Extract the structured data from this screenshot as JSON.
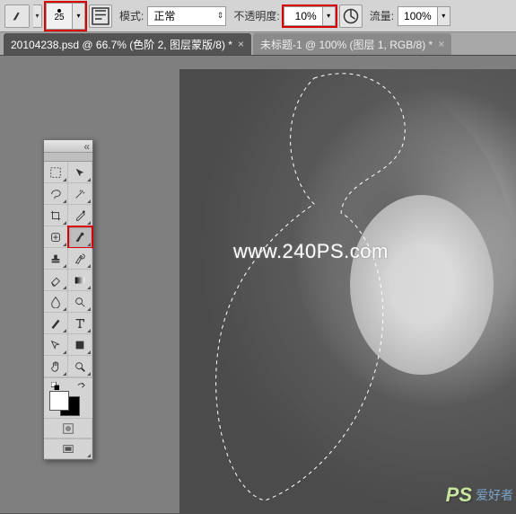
{
  "options_bar": {
    "brush_size": "25",
    "mode_label": "模式:",
    "mode_value": "正常",
    "opacity_label": "不透明度:",
    "opacity_value": "10%",
    "flow_label": "流量:",
    "flow_value": "100%"
  },
  "tabs": [
    {
      "label": "20104238.psd @ 66.7% (色阶 2, 图层蒙版/8) *",
      "active": true
    },
    {
      "label": "未标题-1 @ 100% (图层 1, RGB/8) *",
      "active": false
    }
  ],
  "watermarks": {
    "main": "www.240PS.com",
    "bottom_logo": "PS",
    "bottom_text": "爱好者"
  },
  "tools": {
    "items": [
      [
        "marquee-icon",
        "move-icon"
      ],
      [
        "lasso-icon",
        "wand-icon"
      ],
      [
        "crop-icon",
        "eyedrop-icon"
      ],
      [
        "heal-icon",
        "brush-icon"
      ],
      [
        "stamp-icon",
        "history-brush-icon"
      ],
      [
        "eraser-icon",
        "gradient-icon"
      ],
      [
        "blur-icon",
        "dodge-icon"
      ],
      [
        "pen-icon",
        "type-icon"
      ],
      [
        "path-sel-icon",
        "shape-icon"
      ],
      [
        "hand-icon",
        "zoom-icon"
      ]
    ],
    "active": "brush-icon"
  },
  "icons": {
    "chevron": "▾",
    "updown": "⇕",
    "close": "×",
    "collapse": "«",
    "opts": "≡"
  }
}
